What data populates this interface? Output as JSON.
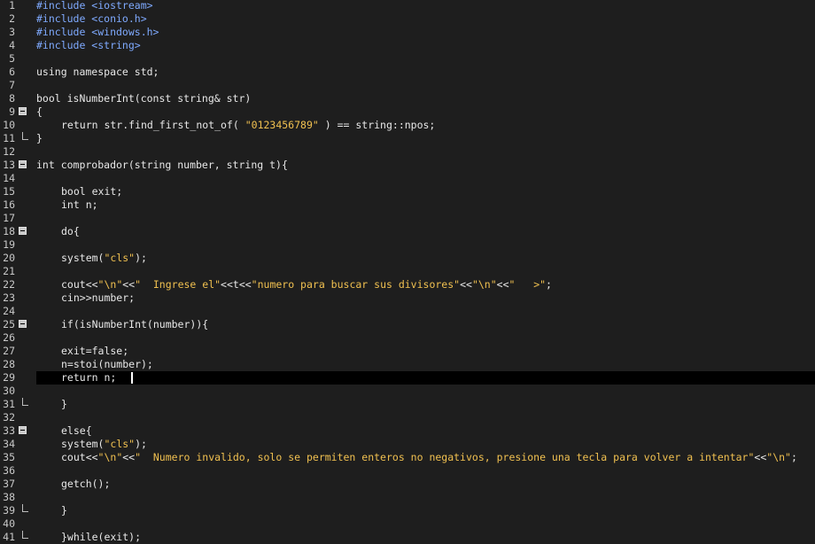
{
  "editor": {
    "current_line": 29,
    "lines": [
      {
        "n": "1",
        "indent": 0,
        "fold": "",
        "tokens": [
          {
            "t": "#include <iostream>",
            "c": "pre"
          }
        ]
      },
      {
        "n": "2",
        "indent": 0,
        "fold": "",
        "tokens": [
          {
            "t": "#include <conio.h>",
            "c": "pre"
          }
        ]
      },
      {
        "n": "3",
        "indent": 0,
        "fold": "",
        "tokens": [
          {
            "t": "#include <windows.h>",
            "c": "pre"
          }
        ]
      },
      {
        "n": "4",
        "indent": 0,
        "fold": "",
        "tokens": [
          {
            "t": "#include <string>",
            "c": "pre"
          }
        ]
      },
      {
        "n": "5",
        "indent": 0,
        "fold": "",
        "tokens": []
      },
      {
        "n": "6",
        "indent": 0,
        "fold": "",
        "tokens": [
          {
            "t": "using namespace std;",
            "c": "txt"
          }
        ]
      },
      {
        "n": "7",
        "indent": 0,
        "fold": "",
        "tokens": []
      },
      {
        "n": "8",
        "indent": 0,
        "fold": "",
        "tokens": [
          {
            "t": "bool isNumberInt(const string& str)",
            "c": "txt"
          }
        ]
      },
      {
        "n": "9",
        "indent": 0,
        "fold": "open",
        "tokens": [
          {
            "t": "{",
            "c": "txt"
          }
        ]
      },
      {
        "n": "10",
        "indent": 1,
        "fold": "",
        "tokens": [
          {
            "t": "return str.find_first_not_of( ",
            "c": "txt"
          },
          {
            "t": "\"0123456789\"",
            "c": "str"
          },
          {
            "t": " ) == string::npos;",
            "c": "txt"
          }
        ]
      },
      {
        "n": "11",
        "indent": 0,
        "fold": "end",
        "tokens": [
          {
            "t": "}",
            "c": "txt"
          }
        ]
      },
      {
        "n": "12",
        "indent": 0,
        "fold": "",
        "tokens": []
      },
      {
        "n": "13",
        "indent": 0,
        "fold": "open",
        "tokens": [
          {
            "t": "int comprobador(string number, string t){",
            "c": "txt"
          }
        ]
      },
      {
        "n": "14",
        "indent": 0,
        "fold": "",
        "tokens": []
      },
      {
        "n": "15",
        "indent": 1,
        "fold": "",
        "tokens": [
          {
            "t": "bool exit;",
            "c": "txt"
          }
        ]
      },
      {
        "n": "16",
        "indent": 1,
        "fold": "",
        "tokens": [
          {
            "t": "int n;",
            "c": "txt"
          }
        ]
      },
      {
        "n": "17",
        "indent": 0,
        "fold": "",
        "tokens": []
      },
      {
        "n": "18",
        "indent": 1,
        "fold": "open",
        "tokens": [
          {
            "t": "do{",
            "c": "txt"
          }
        ]
      },
      {
        "n": "19",
        "indent": 0,
        "fold": "",
        "tokens": []
      },
      {
        "n": "20",
        "indent": 1,
        "fold": "",
        "tokens": [
          {
            "t": "system(",
            "c": "txt"
          },
          {
            "t": "\"cls\"",
            "c": "str"
          },
          {
            "t": ");",
            "c": "txt"
          }
        ]
      },
      {
        "n": "21",
        "indent": 0,
        "fold": "",
        "tokens": []
      },
      {
        "n": "22",
        "indent": 1,
        "fold": "",
        "tokens": [
          {
            "t": "cout<<",
            "c": "txt"
          },
          {
            "t": "\"\\n\"",
            "c": "str"
          },
          {
            "t": "<<",
            "c": "txt"
          },
          {
            "t": "\"  Ingrese el\"",
            "c": "str"
          },
          {
            "t": "<<t<<",
            "c": "txt"
          },
          {
            "t": "\"numero para buscar sus divisores\"",
            "c": "str"
          },
          {
            "t": "<<",
            "c": "txt"
          },
          {
            "t": "\"\\n\"",
            "c": "str"
          },
          {
            "t": "<<",
            "c": "txt"
          },
          {
            "t": "\"   >\"",
            "c": "str"
          },
          {
            "t": ";",
            "c": "txt"
          }
        ]
      },
      {
        "n": "23",
        "indent": 1,
        "fold": "",
        "tokens": [
          {
            "t": "cin>>number;",
            "c": "txt"
          }
        ]
      },
      {
        "n": "24",
        "indent": 0,
        "fold": "",
        "tokens": []
      },
      {
        "n": "25",
        "indent": 1,
        "fold": "open",
        "tokens": [
          {
            "t": "if(isNumberInt(number)){",
            "c": "txt"
          }
        ]
      },
      {
        "n": "26",
        "indent": 0,
        "fold": "",
        "tokens": []
      },
      {
        "n": "27",
        "indent": 1,
        "fold": "",
        "tokens": [
          {
            "t": "exit=false;",
            "c": "txt"
          }
        ]
      },
      {
        "n": "28",
        "indent": 1,
        "fold": "",
        "tokens": [
          {
            "t": "n=stoi(number);",
            "c": "txt"
          }
        ]
      },
      {
        "n": "29",
        "indent": 1,
        "fold": "",
        "caret": true,
        "tokens": [
          {
            "t": "return n;",
            "c": "txt"
          }
        ]
      },
      {
        "n": "30",
        "indent": 0,
        "fold": "",
        "tokens": []
      },
      {
        "n": "31",
        "indent": 1,
        "fold": "end",
        "tokens": [
          {
            "t": "}",
            "c": "txt"
          }
        ]
      },
      {
        "n": "32",
        "indent": 0,
        "fold": "",
        "tokens": []
      },
      {
        "n": "33",
        "indent": 1,
        "fold": "open",
        "tokens": [
          {
            "t": "else{",
            "c": "txt"
          }
        ]
      },
      {
        "n": "34",
        "indent": 1,
        "fold": "",
        "tokens": [
          {
            "t": "system(",
            "c": "txt"
          },
          {
            "t": "\"cls\"",
            "c": "str"
          },
          {
            "t": ");",
            "c": "txt"
          }
        ]
      },
      {
        "n": "35",
        "indent": 1,
        "fold": "",
        "tokens": [
          {
            "t": "cout<<",
            "c": "txt"
          },
          {
            "t": "\"\\n\"",
            "c": "str"
          },
          {
            "t": "<<",
            "c": "txt"
          },
          {
            "t": "\"  Numero invalido, solo se permiten enteros no negativos, presione una tecla para volver a intentar\"",
            "c": "str"
          },
          {
            "t": "<<",
            "c": "txt"
          },
          {
            "t": "\"\\n\"",
            "c": "str"
          },
          {
            "t": ";",
            "c": "txt"
          }
        ]
      },
      {
        "n": "36",
        "indent": 0,
        "fold": "",
        "tokens": []
      },
      {
        "n": "37",
        "indent": 1,
        "fold": "",
        "tokens": [
          {
            "t": "getch();",
            "c": "txt"
          }
        ]
      },
      {
        "n": "38",
        "indent": 0,
        "fold": "",
        "tokens": []
      },
      {
        "n": "39",
        "indent": 1,
        "fold": "end",
        "tokens": [
          {
            "t": "}",
            "c": "txt"
          }
        ]
      },
      {
        "n": "40",
        "indent": 0,
        "fold": "",
        "tokens": []
      },
      {
        "n": "41",
        "indent": 1,
        "fold": "end",
        "tokens": [
          {
            "t": "}while(exit);",
            "c": "txt"
          }
        ]
      }
    ]
  }
}
